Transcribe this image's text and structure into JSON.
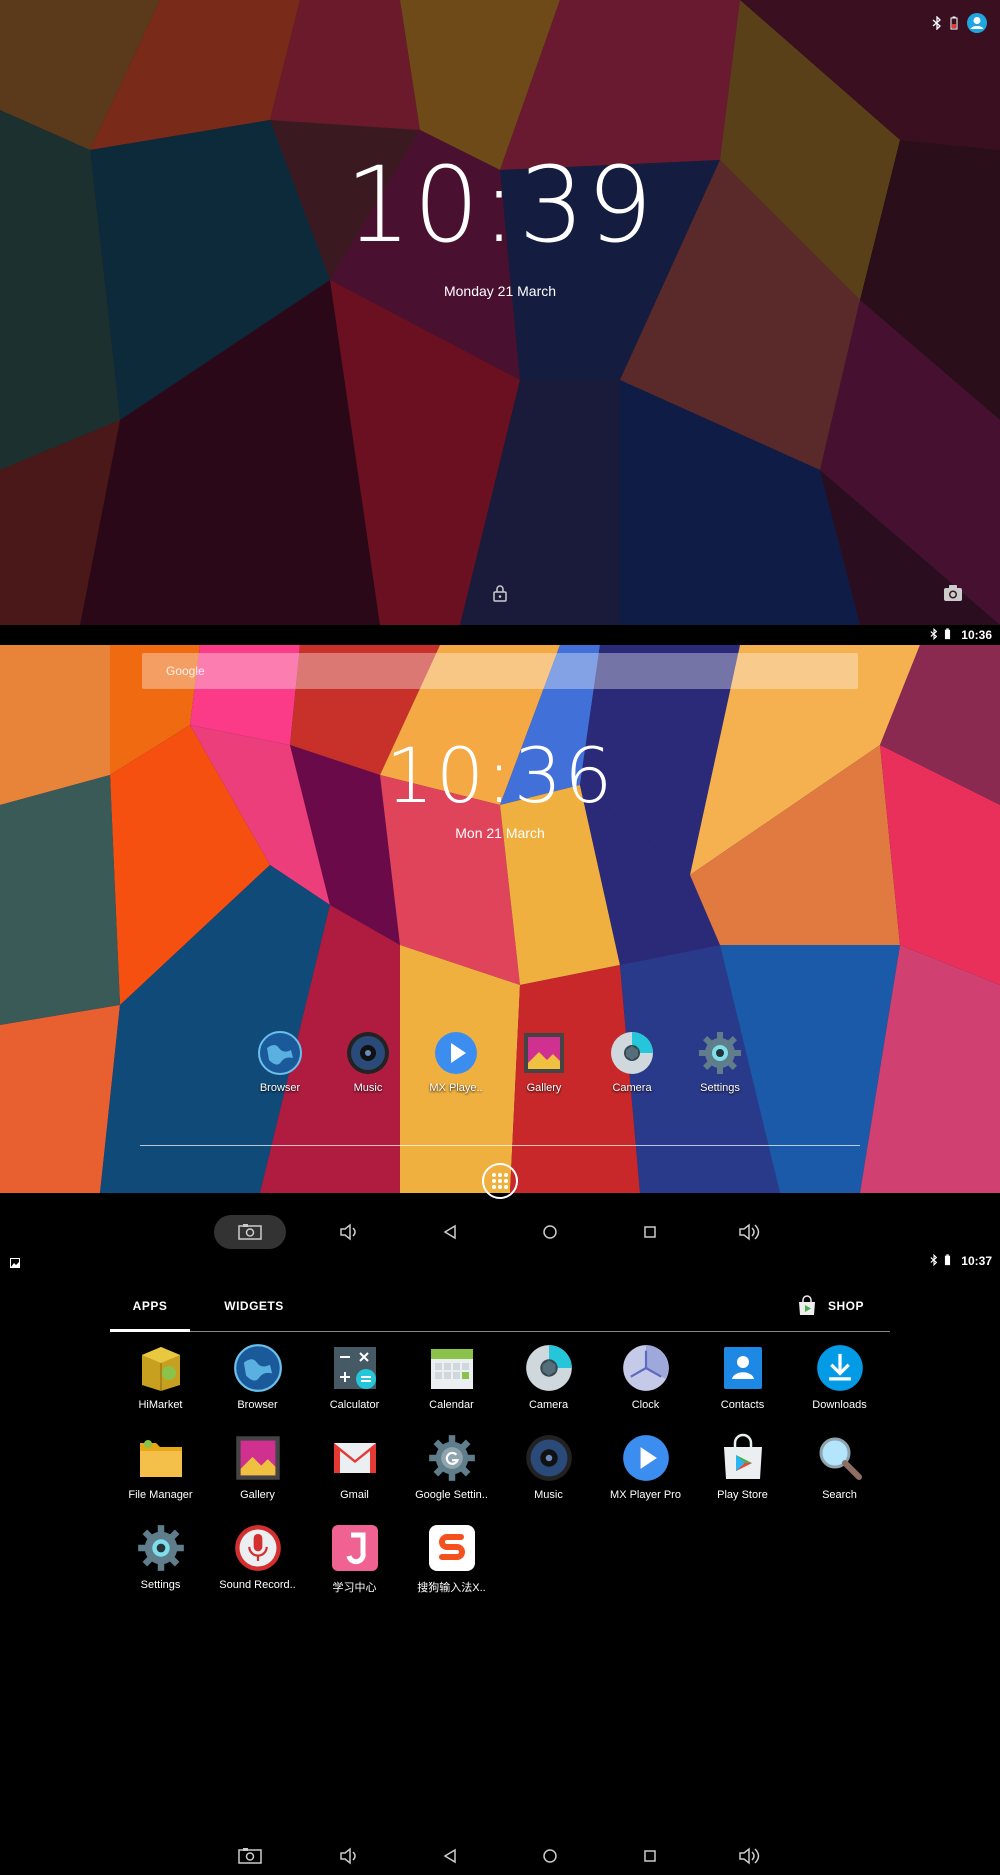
{
  "lock_screen": {
    "time": "10:39",
    "date": "Monday 21 March"
  },
  "home_screen": {
    "status_time": "10:36",
    "search_placeholder": "Google",
    "time": "10:36",
    "date": "Mon 21 March",
    "hotseat": [
      {
        "label": "Browser",
        "icon": "browser-icon"
      },
      {
        "label": "Music",
        "icon": "music-icon"
      },
      {
        "label": "MX Playe..",
        "icon": "mx-player-icon"
      },
      {
        "label": "Gallery",
        "icon": "gallery-icon"
      },
      {
        "label": "Camera",
        "icon": "camera-icon"
      },
      {
        "label": "Settings",
        "icon": "settings-icon"
      }
    ]
  },
  "app_drawer": {
    "status_time": "10:37",
    "tabs": {
      "apps": "APPS",
      "widgets": "WIDGETS",
      "shop": "SHOP"
    },
    "apps": [
      {
        "label": "HiMarket",
        "icon": "himarket-icon"
      },
      {
        "label": "Browser",
        "icon": "browser-icon"
      },
      {
        "label": "Calculator",
        "icon": "calculator-icon"
      },
      {
        "label": "Calendar",
        "icon": "calendar-icon"
      },
      {
        "label": "Camera",
        "icon": "camera-icon"
      },
      {
        "label": "Clock",
        "icon": "clock-icon"
      },
      {
        "label": "Contacts",
        "icon": "contacts-icon"
      },
      {
        "label": "Downloads",
        "icon": "downloads-icon"
      },
      {
        "label": "File Manager",
        "icon": "file-manager-icon"
      },
      {
        "label": "Gallery",
        "icon": "gallery-icon"
      },
      {
        "label": "Gmail",
        "icon": "gmail-icon"
      },
      {
        "label": "Google Settin..",
        "icon": "google-settings-icon"
      },
      {
        "label": "Music",
        "icon": "music-icon"
      },
      {
        "label": "MX Player Pro",
        "icon": "mx-player-icon"
      },
      {
        "label": "Play Store",
        "icon": "play-store-icon"
      },
      {
        "label": "Search",
        "icon": "search-icon"
      },
      {
        "label": "Settings",
        "icon": "settings-icon"
      },
      {
        "label": "Sound Record..",
        "icon": "sound-recorder-icon"
      },
      {
        "label": "学习中心",
        "icon": "study-center-icon"
      },
      {
        "label": "搜狗输入法X..",
        "icon": "sogou-input-icon"
      }
    ]
  }
}
